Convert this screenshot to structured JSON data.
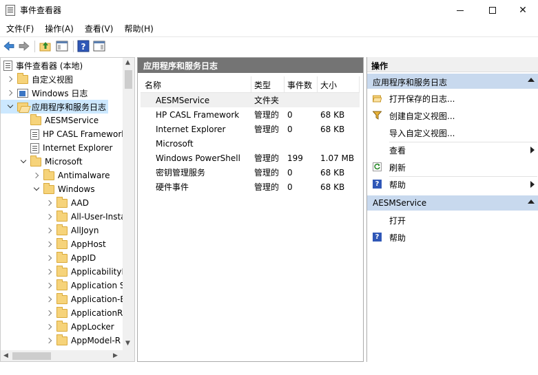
{
  "window": {
    "title": "事件查看器"
  },
  "menubar": {
    "items": [
      "文件(F)",
      "操作(A)",
      "查看(V)",
      "帮助(H)"
    ]
  },
  "tree": {
    "items": [
      {
        "label": "事件查看器 (本地)",
        "icon": "event-viewer-icon",
        "level": 0,
        "state": "open"
      },
      {
        "label": "自定义视图",
        "icon": "folder-icon",
        "level": 1,
        "state": "closed"
      },
      {
        "label": "Windows 日志",
        "icon": "windows-log-icon",
        "level": 1,
        "state": "closed"
      },
      {
        "label": "应用程序和服务日志",
        "icon": "folder-open-icon",
        "level": 1,
        "state": "open",
        "selected": true
      },
      {
        "label": "AESMService",
        "icon": "folder-icon",
        "level": 2,
        "state": "none"
      },
      {
        "label": "HP CASL Framework",
        "icon": "log-icon",
        "level": 2,
        "state": "none"
      },
      {
        "label": "Internet Explorer",
        "icon": "log-icon",
        "level": 2,
        "state": "none"
      },
      {
        "label": "Microsoft",
        "icon": "folder-icon",
        "level": 2,
        "state": "open"
      },
      {
        "label": "Antimalware",
        "icon": "folder-icon",
        "level": 3,
        "state": "closed"
      },
      {
        "label": "Windows",
        "icon": "folder-icon",
        "level": 3,
        "state": "open"
      },
      {
        "label": "AAD",
        "icon": "folder-icon",
        "level": 4,
        "state": "closed"
      },
      {
        "label": "All-User-Insta",
        "icon": "folder-icon",
        "level": 4,
        "state": "closed"
      },
      {
        "label": "AllJoyn",
        "icon": "folder-icon",
        "level": 4,
        "state": "closed"
      },
      {
        "label": "AppHost",
        "icon": "folder-icon",
        "level": 4,
        "state": "closed"
      },
      {
        "label": "AppID",
        "icon": "folder-icon",
        "level": 4,
        "state": "closed"
      },
      {
        "label": "ApplicabilityE",
        "icon": "folder-icon",
        "level": 4,
        "state": "closed"
      },
      {
        "label": "Application S",
        "icon": "folder-icon",
        "level": 4,
        "state": "closed"
      },
      {
        "label": "Application-E",
        "icon": "folder-icon",
        "level": 4,
        "state": "closed"
      },
      {
        "label": "ApplicationRe",
        "icon": "folder-icon",
        "level": 4,
        "state": "closed"
      },
      {
        "label": "AppLocker",
        "icon": "folder-icon",
        "level": 4,
        "state": "closed"
      },
      {
        "label": "AppModel-R",
        "icon": "folder-icon",
        "level": 4,
        "state": "closed"
      }
    ]
  },
  "main": {
    "header": "应用程序和服务日志",
    "columns": [
      "名称",
      "类型",
      "事件数",
      "大小"
    ],
    "rows": [
      {
        "name": "AESMService",
        "type": "文件夹",
        "count": "",
        "size": "",
        "selected": true
      },
      {
        "name": "HP CASL Framework",
        "type": "管理的",
        "count": "0",
        "size": "68 KB"
      },
      {
        "name": "Internet Explorer",
        "type": "管理的",
        "count": "0",
        "size": "68 KB"
      },
      {
        "name": "Microsoft",
        "type": "",
        "count": "",
        "size": ""
      },
      {
        "name": "Windows PowerShell",
        "type": "管理的",
        "count": "199",
        "size": "1.07 MB"
      },
      {
        "name": "密钥管理服务",
        "type": "管理的",
        "count": "0",
        "size": "68 KB"
      },
      {
        "name": "硬件事件",
        "type": "管理的",
        "count": "0",
        "size": "68 KB"
      }
    ]
  },
  "actions": {
    "title": "操作",
    "section1": {
      "title": "应用程序和服务日志",
      "items": [
        {
          "label": "打开保存的日志...",
          "icon": "open-folder-icon"
        },
        {
          "label": "创建自定义视图...",
          "icon": "filter-icon"
        },
        {
          "label": "导入自定义视图...",
          "icon": ""
        },
        {
          "label": "查看",
          "icon": "",
          "submenu": true
        },
        {
          "label": "刷新",
          "icon": "refresh-icon"
        },
        {
          "label": "帮助",
          "icon": "help-icon",
          "submenu": true
        }
      ]
    },
    "section2": {
      "title": "AESMService",
      "items": [
        {
          "label": "打开",
          "icon": ""
        },
        {
          "label": "帮助",
          "icon": "help-icon"
        }
      ]
    }
  }
}
